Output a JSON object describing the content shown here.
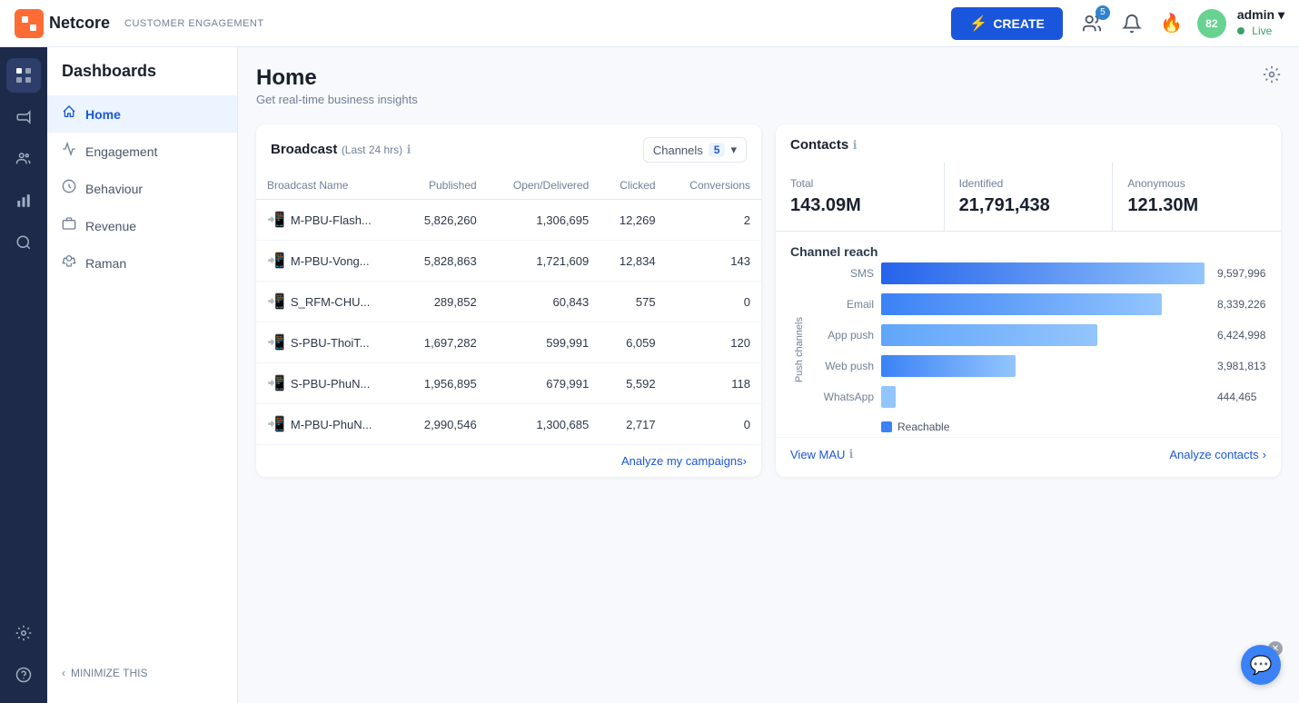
{
  "topnav": {
    "logo_text": "Netcore",
    "logo_initial": "N",
    "product_label": "CUSTOMER ENGAGEMENT",
    "create_label": "CREATE",
    "user_count_badge": "5",
    "score_badge": "82",
    "admin_name": "admin",
    "admin_status": "Live"
  },
  "icon_sidebar": {
    "items": [
      {
        "name": "grid-icon",
        "icon": "⊞",
        "active": true
      },
      {
        "name": "megaphone-icon",
        "icon": "📢",
        "active": false
      },
      {
        "name": "people-icon",
        "icon": "👥",
        "active": false
      },
      {
        "name": "chart-icon",
        "icon": "📊",
        "active": false
      },
      {
        "name": "search-icon",
        "icon": "🔍",
        "active": false
      }
    ],
    "bottom_items": [
      {
        "name": "settings-icon",
        "icon": "⚙"
      },
      {
        "name": "support-icon",
        "icon": "💬"
      }
    ]
  },
  "sidebar": {
    "title": "Dashboards",
    "items": [
      {
        "label": "Home",
        "active": true,
        "icon": "🏠"
      },
      {
        "label": "Engagement",
        "active": false,
        "icon": "🎯"
      },
      {
        "label": "Behaviour",
        "active": false,
        "icon": "🎭"
      },
      {
        "label": "Revenue",
        "active": false,
        "icon": "💰"
      },
      {
        "label": "Raman",
        "active": false,
        "icon": "🤖"
      }
    ],
    "minimize_label": "MINIMIZE THIS"
  },
  "page": {
    "title": "Home",
    "subtitle": "Get real-time business insights"
  },
  "broadcast": {
    "title": "Broadcast",
    "time_range": "(Last 24 hrs)",
    "channels_label": "Channels",
    "channels_count": "5",
    "columns": [
      "Broadcast Name",
      "Published",
      "Open/Delivered",
      "Clicked",
      "Conversions"
    ],
    "rows": [
      {
        "name": "M-PBU-Flash...",
        "published": "5,826,260",
        "open": "1,306,695",
        "clicked": "12,269",
        "conversions": "2"
      },
      {
        "name": "M-PBU-Vong...",
        "published": "5,828,863",
        "open": "1,721,609",
        "clicked": "12,834",
        "conversions": "143"
      },
      {
        "name": "S_RFM-CHU...",
        "published": "289,852",
        "open": "60,843",
        "clicked": "575",
        "conversions": "0"
      },
      {
        "name": "S-PBU-ThoiT...",
        "published": "1,697,282",
        "open": "599,991",
        "clicked": "6,059",
        "conversions": "120"
      },
      {
        "name": "S-PBU-PhuN...",
        "published": "1,956,895",
        "open": "679,991",
        "clicked": "5,592",
        "conversions": "118"
      },
      {
        "name": "M-PBU-PhuN...",
        "published": "2,990,546",
        "open": "1,300,685",
        "clicked": "2,717",
        "conversions": "0"
      }
    ],
    "analyze_label": "Analyze my campaigns",
    "info_tooltip": "Broadcast information"
  },
  "contacts": {
    "title": "Contacts",
    "info_tooltip": "Contacts information",
    "total_label": "Total",
    "total_value": "143.09M",
    "identified_label": "Identified",
    "identified_value": "21,791,438",
    "anonymous_label": "Anonymous",
    "anonymous_value": "121.30M",
    "channel_reach_title": "Channel reach",
    "channels": [
      {
        "label": "SMS",
        "value": 9597996,
        "display": "9,597,996"
      },
      {
        "label": "Email",
        "value": 8339226,
        "display": "8,339,226"
      },
      {
        "label": "App push",
        "value": 6424998,
        "display": "6,424,998"
      },
      {
        "label": "Web push",
        "value": 3981813,
        "display": "3,981,813"
      },
      {
        "label": "WhatsApp",
        "value": 444465,
        "display": "444,465"
      }
    ],
    "y_axis_label": "Push channels",
    "reachable_label": "Reachable",
    "view_mau_label": "View MAU",
    "analyze_label": "Analyze contacts"
  }
}
